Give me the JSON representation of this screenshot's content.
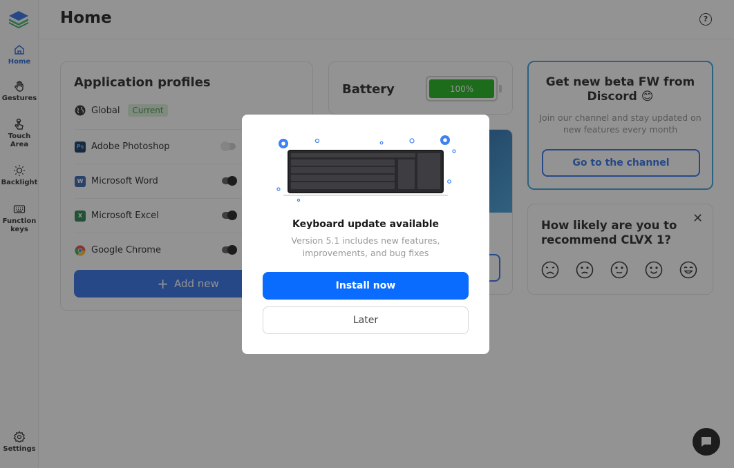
{
  "sidebar": {
    "items": [
      {
        "label": "Home",
        "icon": "home-icon"
      },
      {
        "label": "Gestures",
        "icon": "hand-icon"
      },
      {
        "label": "Touch\nArea",
        "icon": "touch-icon"
      },
      {
        "label": "Backlight",
        "icon": "sun-icon"
      },
      {
        "label": "Function\nkeys",
        "icon": "keyboard-icon"
      }
    ],
    "settings_label": "Settings"
  },
  "header": {
    "title": "Home",
    "help_icon": "?"
  },
  "profiles": {
    "title": "Application profiles",
    "global_label": "Global",
    "current_badge": "Current",
    "apps": [
      {
        "name": "Adobe Photoshop",
        "enabled": false
      },
      {
        "name": "Microsoft Word",
        "enabled": true
      },
      {
        "name": "Microsoft Excel",
        "enabled": true
      },
      {
        "name": "Google Chrome",
        "enabled": true
      }
    ],
    "add_label": "Add new"
  },
  "battery": {
    "title": "Battery",
    "level_label": "100%",
    "level": 1.0
  },
  "discord": {
    "title": "Get new beta FW from Discord 😊",
    "subtitle": "Join our channel and stay updated on new features every month",
    "button_label": "Go to the channel"
  },
  "survey": {
    "title": "How likely are you to recommend CLVX 1?",
    "close": "✕"
  },
  "modal": {
    "title": "Keyboard update available",
    "subtitle": "Version 5.1 includes new features, improvements, and bug fixes",
    "install_label": "Install now",
    "later_label": "Later"
  },
  "colors": {
    "accent": "#0a6cff",
    "battery": "#10b010",
    "discord_border": "#2b9fd9"
  }
}
